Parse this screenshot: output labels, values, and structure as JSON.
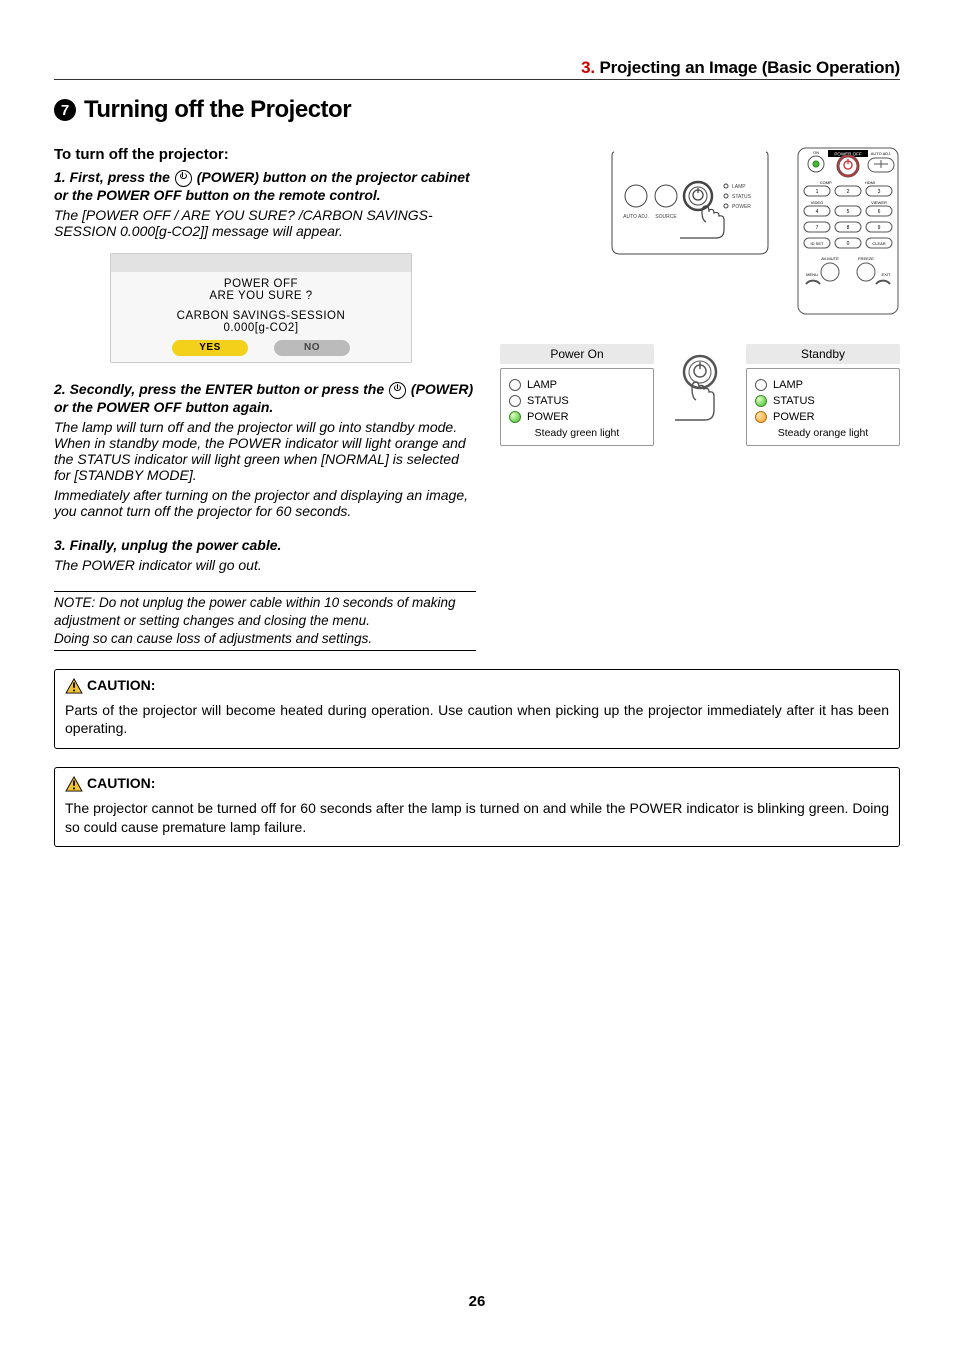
{
  "chapter": {
    "number": "3.",
    "title": "Projecting an Image (Basic Operation)"
  },
  "section": {
    "bullet": "7",
    "title": "Turning off the Projector"
  },
  "intro": "To turn off the projector:",
  "step1": {
    "lead": "1.",
    "text_a": "First, press the",
    "text_b": "(POWER) button on the projector cabinet or the POWER OFF button on the remote control.",
    "desc": "The [POWER OFF / ARE YOU SURE? /CARBON SAVINGS- SESSION 0.000[g-CO2]] message will appear."
  },
  "dialog": {
    "line1": "POWER OFF",
    "line2": "ARE YOU SURE ?",
    "line3": "CARBON SAVINGS-SESSION",
    "line4": "0.000[g-CO2]",
    "yes": "YES",
    "no": "NO"
  },
  "step2": {
    "lead": "2.",
    "text_a": "Secondly, press the ENTER button or press the",
    "text_b": "(POWER) or the POWER OFF button again.",
    "desc1": "The lamp will turn off and the projector will go into standby mode. When in standby mode, the POWER indicator will light orange and the STATUS indicator will light green when [NORMAL] is selected for [STANDBY MODE].",
    "desc2": "Immediately after turning on the projector and displaying an image, you cannot turn off the projector for 60 seconds."
  },
  "step3": {
    "lead": "3.",
    "text": "Finally, unplug the power cable.",
    "desc": "The POWER indicator will go out."
  },
  "note": {
    "l1": "NOTE: Do not unplug the power cable within 10 seconds of making adjustment or setting changes and closing the menu.",
    "l2": "Doing so can cause loss of adjustments and settings."
  },
  "caution1": {
    "label": "CAUTION:",
    "text": "Parts of the projector will become heated during operation. Use caution when picking up the projector immediately after it has been operating."
  },
  "caution2": {
    "label": "CAUTION:",
    "text": "The projector cannot be turned off for 60 seconds after the lamp is turned on and while the POWER indicator is blinking green. Doing so could cause premature lamp failure."
  },
  "panel": {
    "autoadj": "AUTO ADJ.",
    "source": "SOURCE",
    "lamp": "LAMP",
    "status": "STATUS",
    "power": "POWER"
  },
  "remote": {
    "on": "ON",
    "poweroff": "POWER OFF",
    "autoadj": "AUTO ADJ.",
    "comp": "COMP.",
    "hdmi": "HDMI",
    "video": "VIDEO",
    "viewer": "VIEWER",
    "idset": "ID SET",
    "clear": "CLEAR",
    "avmute": "AV-MUTE",
    "freeze": "FREEZE",
    "menu": "MENU",
    "exit": "EXIT"
  },
  "states": {
    "on_hdr": "Power On",
    "sb_hdr": "Standby",
    "lamp": "LAMP",
    "status": "STATUS",
    "power": "POWER",
    "on_foot": "Steady green light",
    "sb_foot": "Steady orange light"
  },
  "pagenum": "26"
}
